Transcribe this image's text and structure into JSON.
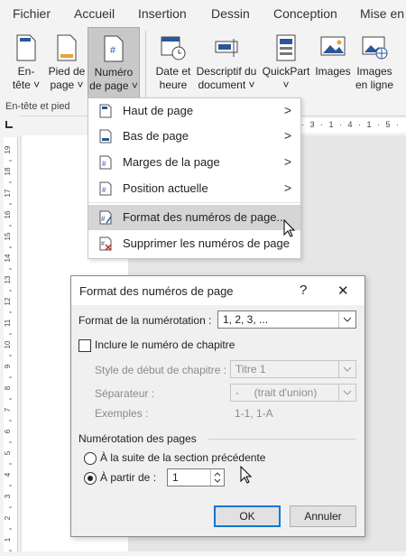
{
  "tabs": [
    "Fichier",
    "Accueil",
    "Insertion",
    "Dessin",
    "Conception",
    "Mise en"
  ],
  "ribbon": {
    "buttons": [
      {
        "line1": "En-",
        "line2": "tête ˅"
      },
      {
        "line1": "Pied de",
        "line2": "page ˅"
      },
      {
        "line1": "Numéro",
        "line2": "de page ˅"
      },
      {
        "line1": "Date et",
        "line2": "heure"
      },
      {
        "line1": "Descriptif du",
        "line2": "document ˅"
      },
      {
        "line1": "QuickPart",
        "line2": "˅"
      },
      {
        "line1": "Images",
        "line2": ""
      },
      {
        "line1": "Images",
        "line2": "en ligne"
      }
    ],
    "group_label": "En-tête et pied"
  },
  "ruler": {
    "marks": "· 3 · 1 · 4 · 1 · 5 ·",
    "vertical": [
      "19",
      "18",
      "17",
      "16",
      "15",
      "14",
      "13",
      "12",
      "11",
      "10",
      "9",
      "8",
      "7",
      "6",
      "5",
      "4",
      "3",
      "2",
      "1"
    ]
  },
  "menu": {
    "items": [
      {
        "label": "Haut de page",
        "arrow": ">"
      },
      {
        "label": "Bas de page",
        "arrow": ">"
      },
      {
        "label": "Marges de la page",
        "arrow": ">"
      },
      {
        "label": "Position actuelle",
        "arrow": ">"
      },
      {
        "label": "Format des numéros de page...",
        "arrow": ""
      },
      {
        "label": "Supprimer les numéros de page",
        "arrow": ""
      }
    ]
  },
  "dialog": {
    "title": "Format des numéros de page",
    "help": "?",
    "close": "✕",
    "format_label": "Format de la numérotation :",
    "format_value": "1, 2, 3, ...",
    "include_chapter": "Inclure le numéro de chapitre",
    "chapter_style_label": "Style de début de chapitre :",
    "chapter_style_value": "Titre 1",
    "separator_label": "Séparateur :",
    "separator_value": "-     (trait d'union)",
    "examples_label": "Exemples :",
    "examples_value": "1-1, 1-A",
    "numbering_group": "Numérotation des pages",
    "continue_label": "À la suite de la section précédente",
    "start_at_label": "À partir de :",
    "start_at_value": "1",
    "ok": "OK",
    "cancel": "Annuler"
  },
  "colors": {
    "accent": "#0078d7",
    "icon_blue": "#2b579a",
    "delete_red": "#c42b1c"
  }
}
